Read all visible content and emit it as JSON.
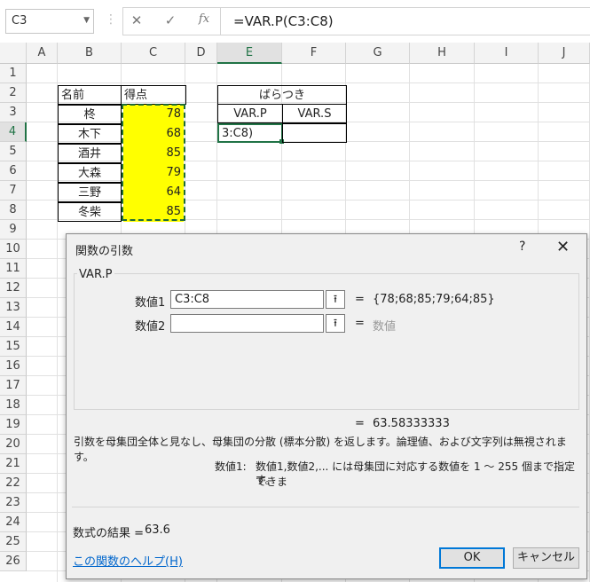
{
  "namebox": {
    "value": "C3"
  },
  "formula_bar": {
    "cancel_glyph": "✕",
    "enter_glyph": "✓",
    "fx_glyph": "fx",
    "formula": "=VAR.P(C3:C8)"
  },
  "columns": [
    "A",
    "B",
    "C",
    "D",
    "E",
    "F",
    "G",
    "H",
    "I",
    "J"
  ],
  "rows": [
    "1",
    "2",
    "3",
    "4",
    "5",
    "6",
    "7",
    "8",
    "9",
    "10",
    "11",
    "12",
    "13",
    "14",
    "15",
    "16",
    "17",
    "18",
    "19",
    "20",
    "21",
    "22",
    "23",
    "24",
    "25",
    "26"
  ],
  "table": {
    "header_name": "名前",
    "header_score": "得点",
    "names": [
      "柊",
      "木下",
      "酒井",
      "大森",
      "三野",
      "冬柴"
    ],
    "scores": [
      "78",
      "68",
      "85",
      "79",
      "64",
      "85"
    ]
  },
  "stats": {
    "title": "ばらつき",
    "col1": "VAR.P",
    "col2": "VAR.S",
    "editing_cell": "3:C8)"
  },
  "dialog": {
    "title": "関数の引数",
    "help_glyph": "?",
    "close_glyph": "✕",
    "function_name": "VAR.P",
    "arg1_label": "数値1",
    "arg1_value": "C3:C8",
    "arg1_eq": "=",
    "arg1_result": "{78;68;85;79;64;85}",
    "arg2_label": "数値2",
    "arg2_value": "",
    "arg2_eq": "=",
    "arg2_hint": "数値",
    "collapse_glyph": "⭱",
    "total_eq": "=",
    "total_value": "63.58333333",
    "description": "引数を母集団全体と見なし、母集団の分散 (標本分散) を返します。論理値、および文字列は無視されます。",
    "arg_desc_label": "数値1:",
    "arg_desc_line1": "数値1,数値2,... には母集団に対応する数値を 1 ～ 255 個まで指定できま",
    "arg_desc_line2": "す。",
    "result_label": "数式の結果 =",
    "result_value": "63.6",
    "help_link": "この関数のヘルプ(H)",
    "ok": "OK",
    "cancel": "キャンセル"
  }
}
